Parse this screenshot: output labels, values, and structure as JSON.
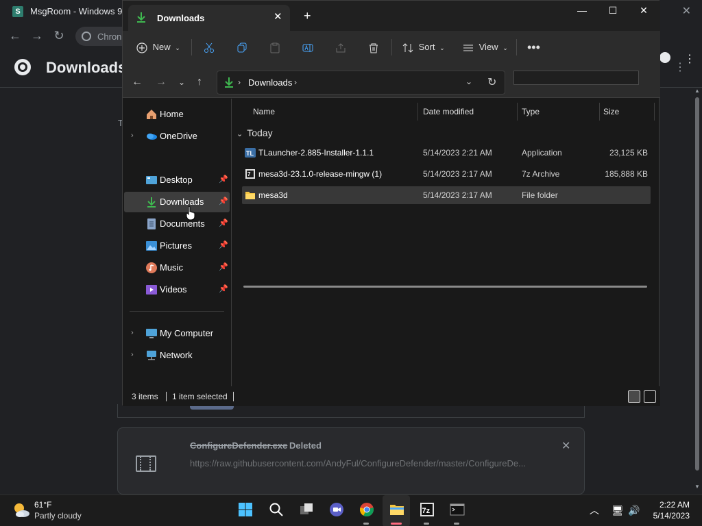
{
  "chrome": {
    "window_title": "MsgRoom - Windows 9",
    "omnibox_text": "Chron",
    "page_title": "Downloads",
    "partial_letter": "T",
    "download": {
      "filename": "ConfigureDefender.exe",
      "status": "Deleted",
      "url": "https://raw.githubusercontent.com/AndyFul/ConfigureDefender/master/ConfigureDe..."
    }
  },
  "explorer": {
    "tab_title": "Downloads",
    "toolbar": {
      "new_label": "New",
      "sort_label": "Sort",
      "view_label": "View"
    },
    "address_path": "Downloads",
    "nav": {
      "home": "Home",
      "onedrive": "OneDrive",
      "desktop": "Desktop",
      "downloads": "Downloads",
      "documents": "Documents",
      "pictures": "Pictures",
      "music": "Music",
      "videos": "Videos",
      "my_computer": "My Computer",
      "network": "Network"
    },
    "columns": {
      "name": "Name",
      "date": "Date modified",
      "type": "Type",
      "size": "Size"
    },
    "group": "Today",
    "files": [
      {
        "name": "TLauncher-2.885-Installer-1.1.1",
        "date": "5/14/2023 2:21 AM",
        "type": "Application",
        "size": "23,125 KB"
      },
      {
        "name": "mesa3d-23.1.0-release-mingw (1)",
        "date": "5/14/2023 2:17 AM",
        "type": "7z Archive",
        "size": "185,888 KB"
      },
      {
        "name": "mesa3d",
        "date": "5/14/2023 2:17 AM",
        "type": "File folder",
        "size": ""
      }
    ],
    "status": {
      "items": "3 items",
      "selected": "1 item selected"
    }
  },
  "taskbar": {
    "weather_temp": "61°F",
    "weather_desc": "Partly cloudy",
    "time": "2:22 AM",
    "date": "5/14/2023"
  },
  "colors": {
    "accent_green": "#3fb950",
    "folder_yellow": "#f4c542",
    "selection": "#383838"
  }
}
